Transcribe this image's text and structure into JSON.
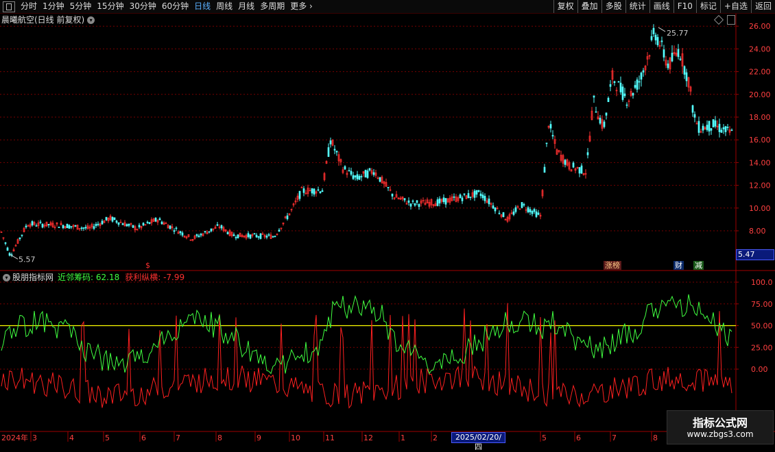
{
  "toolbar": {
    "periods": [
      "分时",
      "1分钟",
      "5分钟",
      "15分钟",
      "30分钟",
      "60分钟",
      "日线",
      "周线",
      "月线",
      "多周期",
      "更多"
    ],
    "active_period": "日线",
    "right_buttons": [
      "复权",
      "叠加",
      "多股",
      "统计",
      "画线",
      "F10",
      "标记",
      "+自选",
      "返回"
    ]
  },
  "main_chart": {
    "title": "晨曦航空(日线 前复权)",
    "price_ticks": [
      "26.00",
      "24.00",
      "22.00",
      "20.00",
      "18.00",
      "16.00",
      "14.00",
      "12.00",
      "10.00",
      "8.00"
    ],
    "high_label": "25.77",
    "low_label": "5.57",
    "current_price": "5.47",
    "tags": {
      "limit": "涨榜",
      "finance": "财",
      "reduce": "减",
      "dollar": "$"
    },
    "colors": {
      "up": "#ff3030",
      "down": "#54ffff",
      "grid": "#7a0000"
    }
  },
  "indicator": {
    "name": "股朋指标网",
    "line1_label": "近邻筹码: 62.18",
    "line2_label": "获利纵横: -7.99",
    "ticks": [
      "100.0",
      "75.00",
      "50.00",
      "25.00",
      "0.00"
    ],
    "colors": {
      "line1": "#40ff40",
      "line2": "#ff2020",
      "ref": "#ffff00"
    }
  },
  "x_axis": {
    "year_label": "2024年",
    "months": [
      "3",
      "4",
      "5",
      "6",
      "7",
      "8",
      "9",
      "10",
      "11",
      "12",
      "1",
      "2",
      "5",
      "6",
      "7",
      "8"
    ],
    "highlight_date": "2025/02/20/四"
  },
  "watermark": {
    "title": "指标公式网",
    "url": "www.zbgs3.com"
  }
}
